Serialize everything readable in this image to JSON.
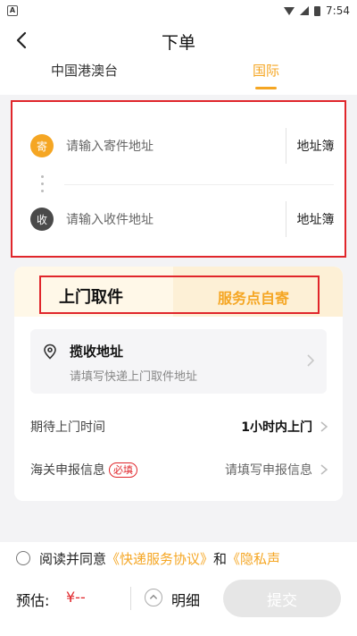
{
  "status_bar": {
    "time": "7:54",
    "notification_icon": "A"
  },
  "header": {
    "title": "下单",
    "back_icon": "chevron-left-icon"
  },
  "tabs": [
    {
      "label": "中国港澳台",
      "active": false
    },
    {
      "label": "国际",
      "active": true
    }
  ],
  "address": {
    "sender": {
      "badge": "寄",
      "placeholder": "请输入寄件地址",
      "book_label": "地址簿"
    },
    "receiver": {
      "badge": "收",
      "placeholder": "请输入收件地址",
      "book_label": "地址簿"
    }
  },
  "service": {
    "tabs": [
      {
        "label": "上门取件",
        "active": true
      },
      {
        "label": "服务点自寄",
        "active": false
      }
    ],
    "pickup": {
      "title": "揽收地址",
      "subtitle": "请填写快递上门取件地址"
    },
    "rows": [
      {
        "label": "期待上门时间",
        "value": "1小时内上门"
      },
      {
        "label": "海关申报信息",
        "required_tag": "必填",
        "value": "请填写申报信息"
      }
    ]
  },
  "agreement": {
    "prefix": "阅读并同意",
    "link1": "《快递服务协议》",
    "middle": "和",
    "link2": "《隐私声"
  },
  "footer": {
    "estimate_label": "预估:",
    "price": "¥--",
    "detail_label": "明细",
    "submit_label": "提交"
  },
  "colors": {
    "accent": "#f5a623",
    "highlight_box": "#e0262b",
    "price": "#e0262b"
  }
}
